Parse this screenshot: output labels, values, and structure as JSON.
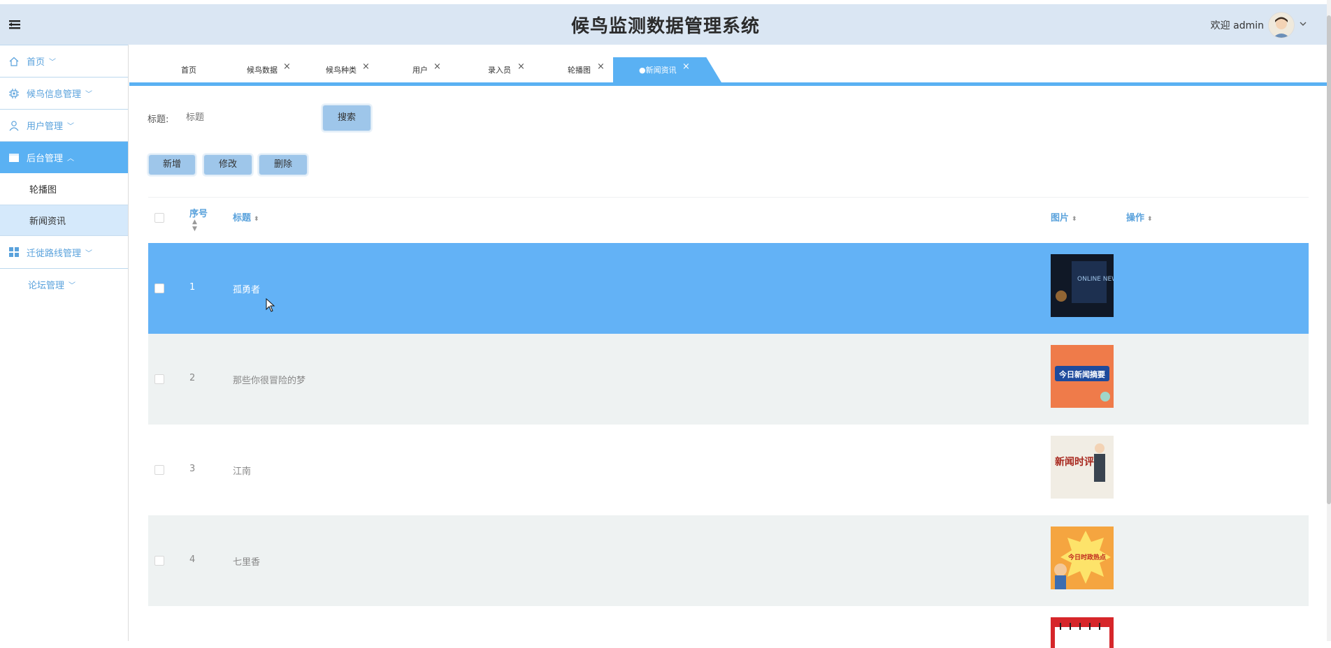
{
  "header": {
    "title": "候鸟监测数据管理系统",
    "welcome": "欢迎 admin"
  },
  "sidebar": {
    "items": [
      {
        "label": "首页",
        "icon": "home-icon"
      },
      {
        "label": "候鸟信息管理",
        "icon": "chip-icon"
      },
      {
        "label": "用户管理",
        "icon": "user-icon"
      },
      {
        "label": "后台管理",
        "icon": "table-icon",
        "expanded": true,
        "children": [
          {
            "label": "轮播图"
          },
          {
            "label": "新闻资讯",
            "selected": true
          }
        ]
      },
      {
        "label": "迁徙路线管理",
        "icon": "grid-icon"
      },
      {
        "label": "论坛管理",
        "icon": ""
      }
    ]
  },
  "tabs": [
    {
      "label": "首页",
      "closable": false
    },
    {
      "label": "候鸟数据",
      "closable": true
    },
    {
      "label": "候鸟种类",
      "closable": true
    },
    {
      "label": "用户",
      "closable": true
    },
    {
      "label": "录入员",
      "closable": true
    },
    {
      "label": "轮播图",
      "closable": true
    },
    {
      "label": "●新闻资讯",
      "closable": true,
      "active": true
    }
  ],
  "filter": {
    "label": "标题:",
    "placeholder": "标题",
    "search_label": "搜索"
  },
  "actions": {
    "add": "新增",
    "edit": "修改",
    "delete": "删除"
  },
  "table": {
    "headers": {
      "index": "序号",
      "title": "标题",
      "image": "图片",
      "ops": "操作"
    },
    "rows": [
      {
        "index": "1",
        "title": "孤勇者",
        "image": "ONLINE NEWS",
        "highlighted": true
      },
      {
        "index": "2",
        "title": "那些你很冒险的梦",
        "image": "今日新闻摘要"
      },
      {
        "index": "3",
        "title": "江南",
        "image": "新闻时评"
      },
      {
        "index": "4",
        "title": "七里香",
        "image": "今日时政热点"
      }
    ]
  },
  "colors": {
    "accent": "#5ab1f3",
    "header_bg": "#dae6f3",
    "row_highlight": "#63b2f6",
    "row_alt": "#eef2f2"
  }
}
